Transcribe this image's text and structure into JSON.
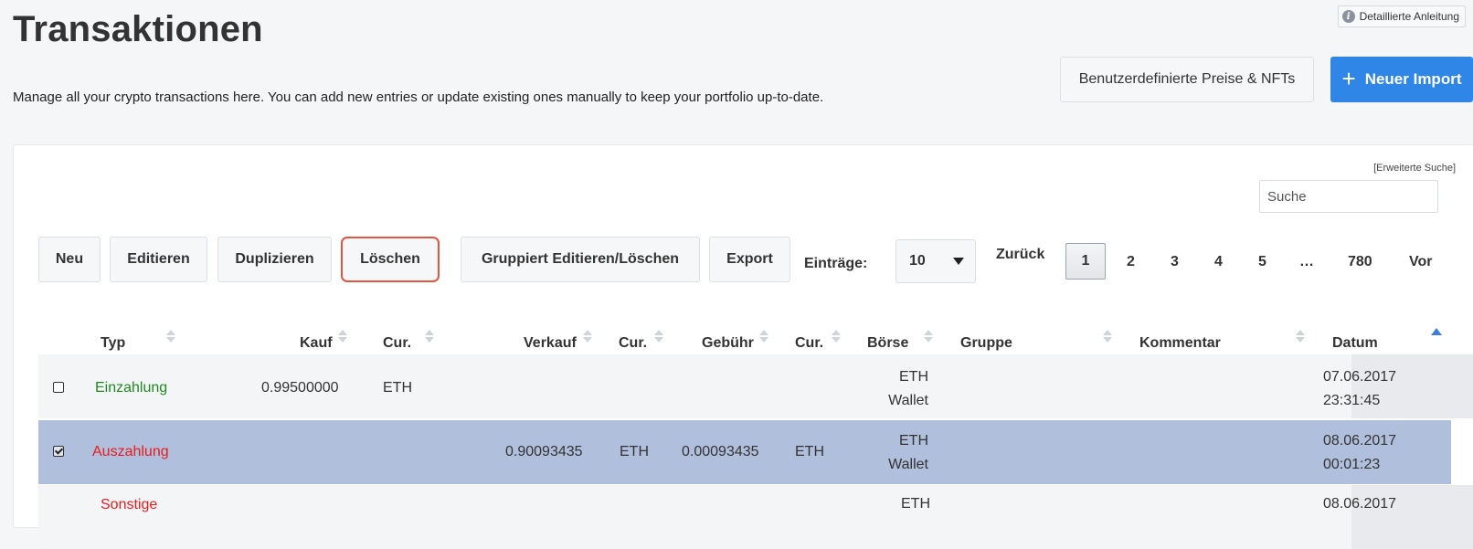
{
  "header": {
    "title": "Transaktionen",
    "subtitle": "Manage all your crypto transactions here. You can add new entries or update existing ones manually to keep your portfolio up-to-date.",
    "guide_label": "Detaillierte Anleitung",
    "custom_prices_label": "Benutzerdefinierte Preise & NFTs",
    "new_import_label": "Neuer Import"
  },
  "search": {
    "advanced_label": "[Erweiterte Suche]",
    "placeholder": "Suche"
  },
  "toolbar": {
    "new": "Neu",
    "edit": "Editieren",
    "duplicate": "Duplizieren",
    "delete": "Löschen",
    "group_edit": "Gruppiert Editieren/Löschen",
    "export": "Export",
    "entries_label": "Einträge:",
    "entries_value": "10"
  },
  "pagination": {
    "prev": "Zurück",
    "pages": [
      "1",
      "2",
      "3",
      "4",
      "5",
      "…",
      "780"
    ],
    "next": "Vor",
    "active": "1"
  },
  "table": {
    "columns": [
      "Typ",
      "Kauf",
      "Cur.",
      "Verkauf",
      "Cur.",
      "Gebühr",
      "Cur.",
      "Börse",
      "Gruppe",
      "Kommentar",
      "Datum"
    ],
    "rows": [
      {
        "selected": false,
        "type": "Einzahlung",
        "buy": "0.99500000",
        "buy_cur": "ETH",
        "sell": "",
        "sell_cur": "",
        "fee": "",
        "fee_cur": "",
        "exchange_line1": "ETH",
        "exchange_line2": "Wallet",
        "group": "",
        "comment": "",
        "date": "07.06.2017",
        "time": "23:31:45"
      },
      {
        "selected": true,
        "type": "Auszahlung",
        "buy": "",
        "buy_cur": "",
        "sell": "0.90093435",
        "sell_cur": "ETH",
        "fee": "0.00093435",
        "fee_cur": "ETH",
        "exchange_line1": "ETH",
        "exchange_line2": "Wallet",
        "group": "",
        "comment": "",
        "date": "08.06.2017",
        "time": "00:01:23"
      },
      {
        "selected": false,
        "type": "Sonstige",
        "exchange_line1": "ETH",
        "date": "08.06.2017"
      }
    ]
  },
  "colors": {
    "primary": "#2f86e6",
    "selected_row": "#b0bfdc",
    "deposit": "#1f8a1f",
    "withdrawal": "#e81c1c",
    "highlight_border": "#e2553f"
  }
}
